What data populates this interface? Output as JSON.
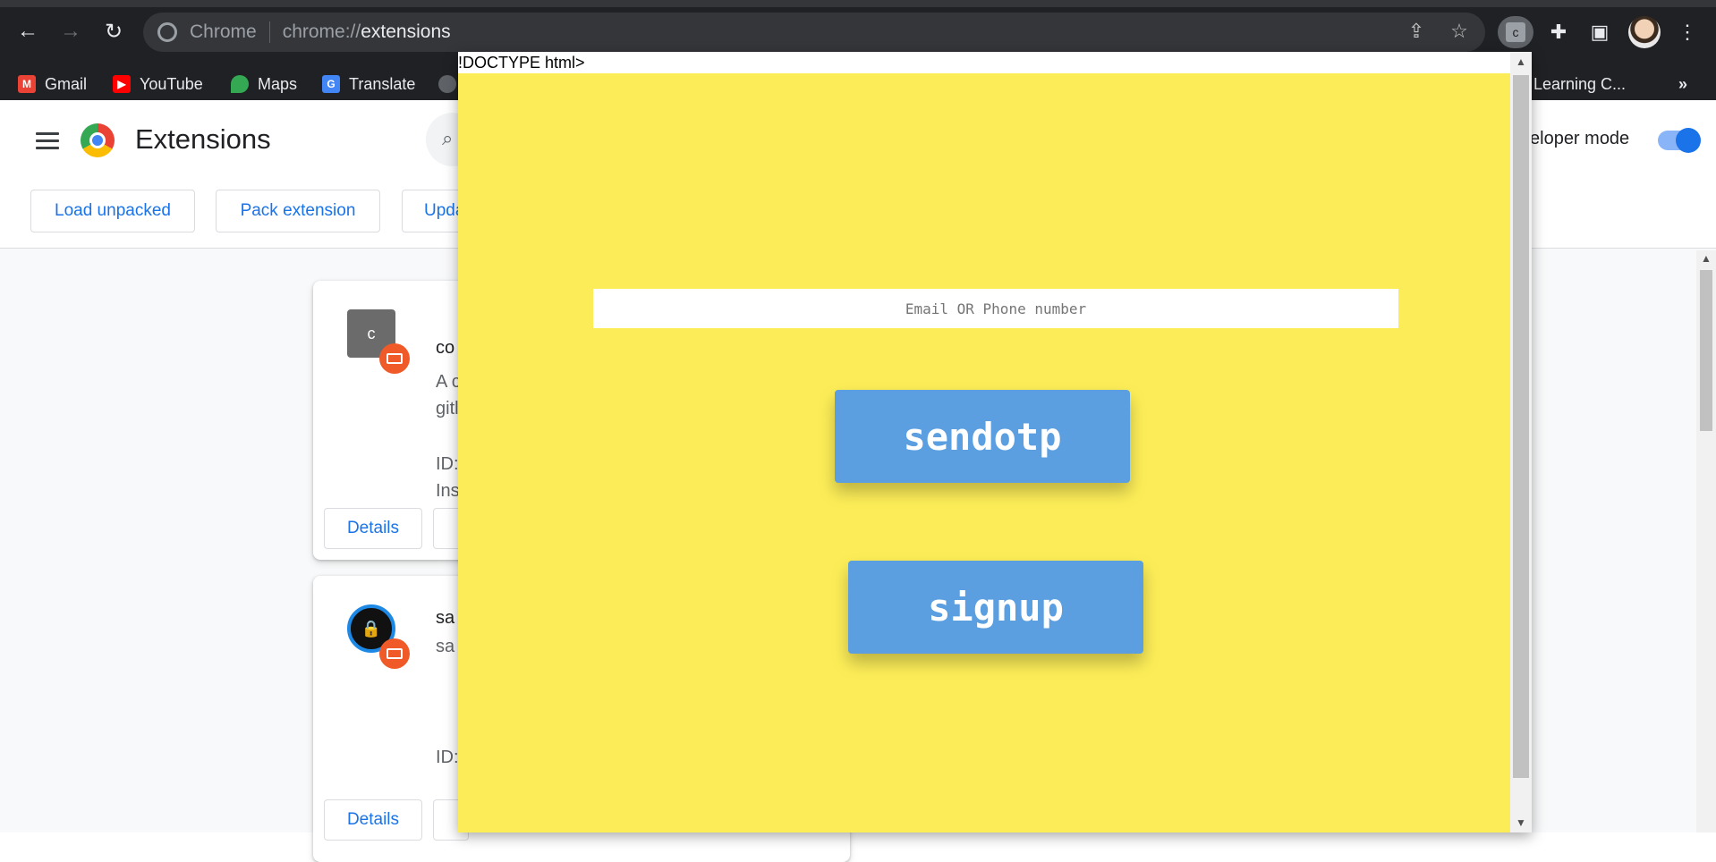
{
  "browser": {
    "site_label": "Chrome",
    "url_scheme": "chrome://",
    "url_host": "extensions",
    "extension_chip_letter": "c",
    "overflow_label": "»"
  },
  "bookmarks": [
    {
      "label": "Gmail",
      "icon": "gmail-icon",
      "color": "#ea4335"
    },
    {
      "label": "YouTube",
      "icon": "youtube-icon",
      "color": "#ff0000"
    },
    {
      "label": "Maps",
      "icon": "maps-icon",
      "color": "#34a853"
    },
    {
      "label": "Translate",
      "icon": "translate-icon",
      "color": "#4285f4"
    },
    {
      "label": "",
      "icon": "globe-icon",
      "color": "#9aa0a6"
    },
    {
      "label": "Learning C...",
      "icon": "bookmark-icon",
      "color": "#9aa0a6"
    }
  ],
  "extensions_page": {
    "title": "Extensions",
    "developer_mode_label": "veloper mode",
    "buttons": {
      "load_unpacked": "Load unpacked",
      "pack_extension": "Pack extension",
      "update": "Upda"
    },
    "cards": [
      {
        "icon_letter": "c",
        "name": "co",
        "desc_line1": "A c",
        "desc_line2": "gitl",
        "id_label": "ID:",
        "inspect_label": "Ins",
        "details_label": "Details"
      },
      {
        "icon_letter": "",
        "name": "sa",
        "desc_line1": "sa",
        "id_label": "ID:",
        "details_label": "Details"
      }
    ]
  },
  "popup": {
    "doctype_text": "!DOCTYPE html>",
    "email_placeholder": "Email OR Phone number",
    "sendotp_label": "sendotp",
    "signup_label": "signup",
    "background_color": "#fced58",
    "button_color": "#5b9fe0"
  }
}
